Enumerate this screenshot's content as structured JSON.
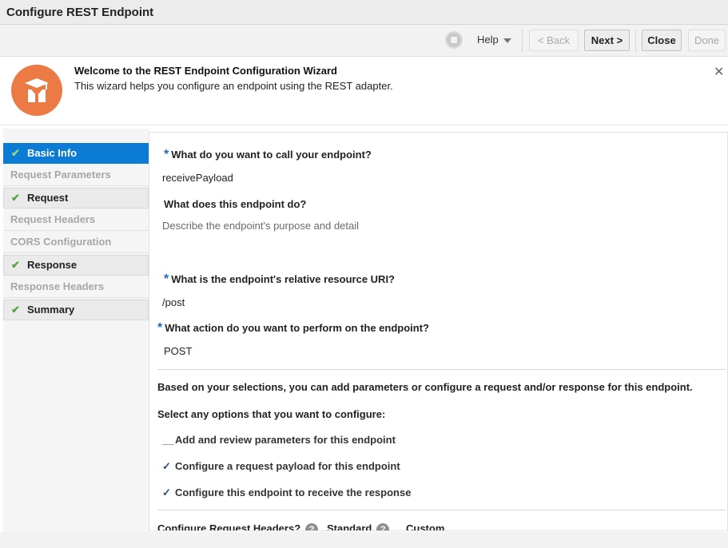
{
  "window": {
    "title": "Configure REST Endpoint"
  },
  "toolbar": {
    "help_label": "Help",
    "back_label": "< Back",
    "next_label": "Next >",
    "close_label": "Close",
    "done_label": "Done"
  },
  "welcome": {
    "title": "Welcome to the REST Endpoint Configuration Wizard",
    "description": "This wizard helps you configure an endpoint using the REST adapter.",
    "close_glyph": "✕",
    "accent_color": "#ec7a45"
  },
  "nav": {
    "items": [
      {
        "label": "Basic Info",
        "state": "active",
        "check": "✔"
      },
      {
        "label": "Request Parameters",
        "state": "disabled",
        "check": ""
      },
      {
        "label": "Request",
        "state": "complete",
        "check": "✔"
      },
      {
        "label": "Request Headers",
        "state": "disabled",
        "check": ""
      },
      {
        "label": "CORS Configuration",
        "state": "disabled",
        "check": ""
      },
      {
        "label": "Response",
        "state": "complete",
        "check": "✔"
      },
      {
        "label": "Response Headers",
        "state": "disabled",
        "check": ""
      },
      {
        "label": "Summary",
        "state": "complete",
        "check": "✔"
      }
    ],
    "active_color": "#0c7bd3"
  },
  "form": {
    "required_mark": "*",
    "name_question": "What do you want to call your endpoint?",
    "name_value": "receivePayload",
    "desc_question": "What does this endpoint do?",
    "desc_placeholder": "Describe the endpoint's purpose and detail",
    "uri_question": "What is the endpoint's relative resource URI?",
    "uri_value": "/post",
    "action_question": "What action do you want to perform on the endpoint?",
    "action_value": "POST",
    "based_text": "Based on your selections, you can add parameters or configure a request and/or response for this endpoint.",
    "select_text": "Select any options that you want to configure:",
    "options": [
      {
        "label": "Add and review parameters for this endpoint",
        "mark": "__"
      },
      {
        "label": "Configure a request payload for this endpoint",
        "mark": "✓"
      },
      {
        "label": "Configure this endpoint to receive the response",
        "mark": "✓"
      }
    ],
    "headers_label": "Configure Request Headers?",
    "standard_label": "Standard",
    "custom_label": "Custom",
    "help_glyph": "?"
  }
}
